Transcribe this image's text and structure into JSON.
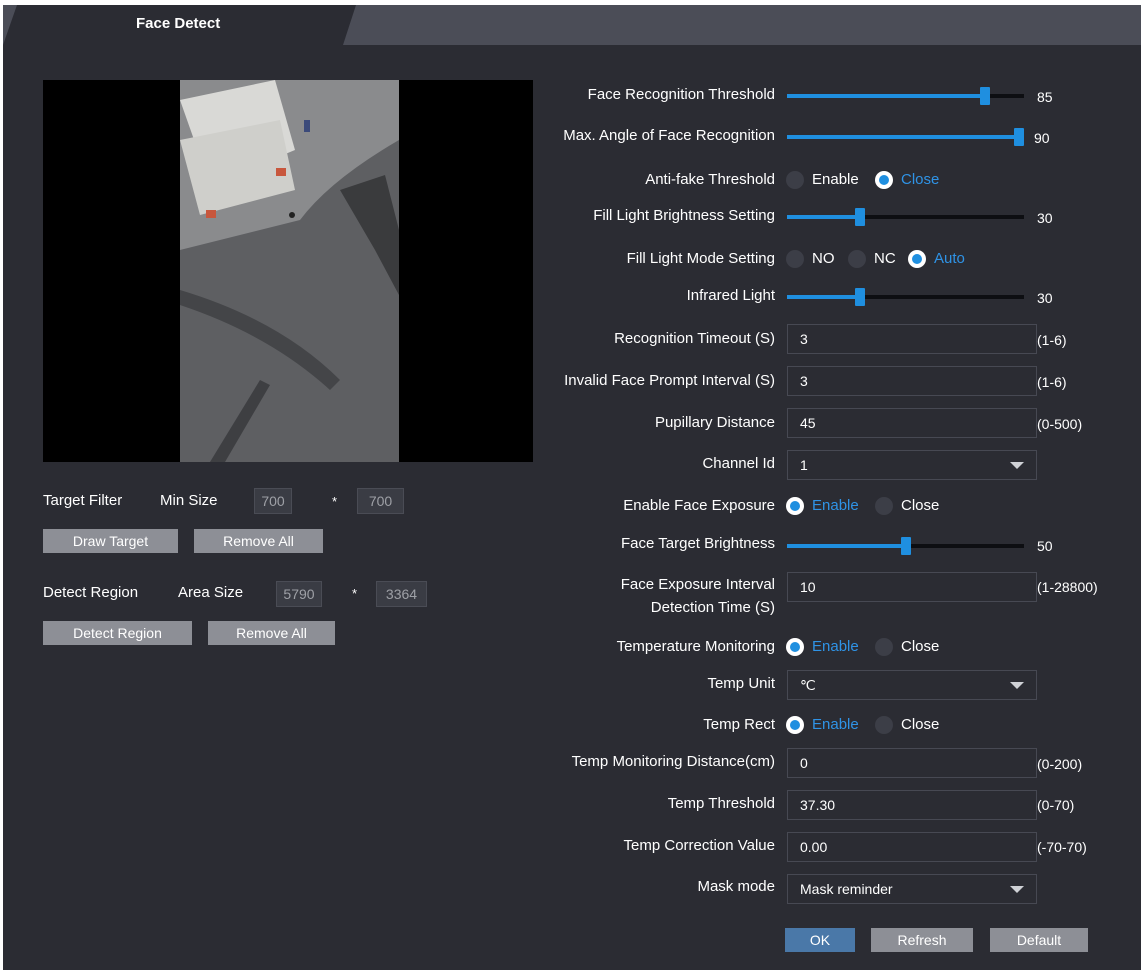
{
  "tab": {
    "title": "Face Detect"
  },
  "left": {
    "target_filter": {
      "label": "Target Filter",
      "min_size_label": "Min Size",
      "w": "700",
      "sep": "*",
      "h": "700"
    },
    "draw_target": "Draw Target",
    "remove_all_1": "Remove All",
    "detect_region": {
      "label": "Detect Region",
      "area_size_label": "Area Size",
      "w": "5790",
      "sep": "*",
      "h": "3364"
    },
    "detect_region_btn": "Detect Region",
    "remove_all_2": "Remove All"
  },
  "settings": {
    "face_recognition_threshold": {
      "label": "Face Recognition Threshold",
      "value": "85",
      "fraction": 0.85
    },
    "max_angle": {
      "label": "Max. Angle of Face Recognition",
      "value": "90",
      "fraction": 1.0
    },
    "anti_fake": {
      "label": "Anti-fake Threshold",
      "opt1": "Enable",
      "opt2": "Close",
      "selected": "Close"
    },
    "fill_light_brightness": {
      "label": "Fill Light Brightness Setting",
      "value": "30",
      "fraction": 0.3
    },
    "fill_light_mode": {
      "label": "Fill Light Mode Setting",
      "opt1": "NO",
      "opt2": "NC",
      "opt3": "Auto",
      "selected": "Auto"
    },
    "infrared_light": {
      "label": "Infrared Light",
      "value": "30",
      "fraction": 0.3
    },
    "recognition_timeout": {
      "label": "Recognition Timeout (S)",
      "value": "3",
      "range": "(1-6)"
    },
    "invalid_face_prompt": {
      "label": "Invalid Face Prompt Interval (S)",
      "value": "3",
      "range": "(1-6)"
    },
    "pupillary_distance": {
      "label": "Pupillary Distance",
      "value": "45",
      "range": "(0-500)"
    },
    "channel_id": {
      "label": "Channel Id",
      "value": "1"
    },
    "enable_face_exposure": {
      "label": "Enable Face Exposure",
      "opt1": "Enable",
      "opt2": "Close",
      "selected": "Enable"
    },
    "face_target_brightness": {
      "label": "Face Target Brightness",
      "value": "50",
      "fraction": 0.5
    },
    "face_exposure_interval": {
      "label_line1": "Face Exposure Interval",
      "label_line2": "Detection Time (S)",
      "value": "10",
      "range": "(1-28800)"
    },
    "temperature_monitoring": {
      "label": "Temperature Monitoring",
      "opt1": "Enable",
      "opt2": "Close",
      "selected": "Enable"
    },
    "temp_unit": {
      "label": "Temp Unit",
      "value": "℃"
    },
    "temp_rect": {
      "label": "Temp Rect",
      "opt1": "Enable",
      "opt2": "Close",
      "selected": "Enable"
    },
    "temp_monitoring_distance": {
      "label": "Temp Monitoring Distance(cm)",
      "value": "0",
      "range": "(0-200)"
    },
    "temp_threshold": {
      "label": "Temp Threshold",
      "value": "37.30",
      "range": "(0-70)"
    },
    "temp_correction": {
      "label": "Temp Correction Value",
      "value": "0.00",
      "range": "(-70-70)"
    },
    "mask_mode": {
      "label": "Mask mode",
      "value": "Mask reminder"
    }
  },
  "buttons": {
    "ok": "OK",
    "refresh": "Refresh",
    "default": "Default"
  },
  "colors": {
    "accent": "#1f8fe0",
    "panel": "#2b2c33",
    "header": "#4b4d57"
  }
}
